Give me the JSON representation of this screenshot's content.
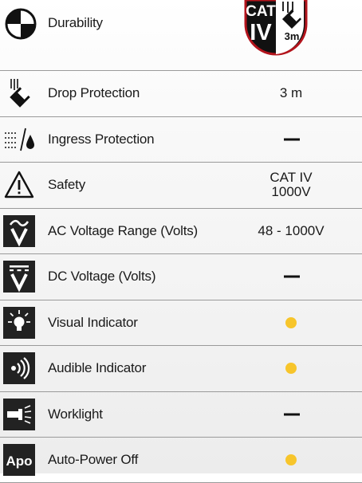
{
  "header": {
    "label": "Durability",
    "badge": {
      "line1": "CAT",
      "line2": "IV",
      "drop": "3m"
    }
  },
  "rows": [
    {
      "icon": "drop-icon",
      "label": "Drop Protection",
      "value": "3 m",
      "kind": "text"
    },
    {
      "icon": "ingress-icon",
      "label": "Ingress Protection",
      "value": "",
      "kind": "dash"
    },
    {
      "icon": "warning-icon",
      "label": "Safety",
      "value": "CAT IV\n1000V",
      "kind": "text"
    },
    {
      "icon": "ac-voltage-icon",
      "label": "AC Voltage Range (Volts)",
      "value": "48 - 1000V",
      "kind": "text"
    },
    {
      "icon": "dc-voltage-icon",
      "label": "DC Voltage (Volts)",
      "value": "",
      "kind": "dash"
    },
    {
      "icon": "light-bulb-icon",
      "label": "Visual Indicator",
      "value": "",
      "kind": "dot"
    },
    {
      "icon": "sound-icon",
      "label": "Audible Indicator",
      "value": "",
      "kind": "dot"
    },
    {
      "icon": "flashlight-icon",
      "label": "Worklight",
      "value": "",
      "kind": "dash"
    },
    {
      "icon": "apo-icon",
      "label": "Auto-Power Off",
      "value": "",
      "kind": "dot",
      "icon_text": "Apo"
    }
  ],
  "colors": {
    "dot": "#f7c52b",
    "badge_ring": "#b3141c",
    "dark": "#222222"
  }
}
